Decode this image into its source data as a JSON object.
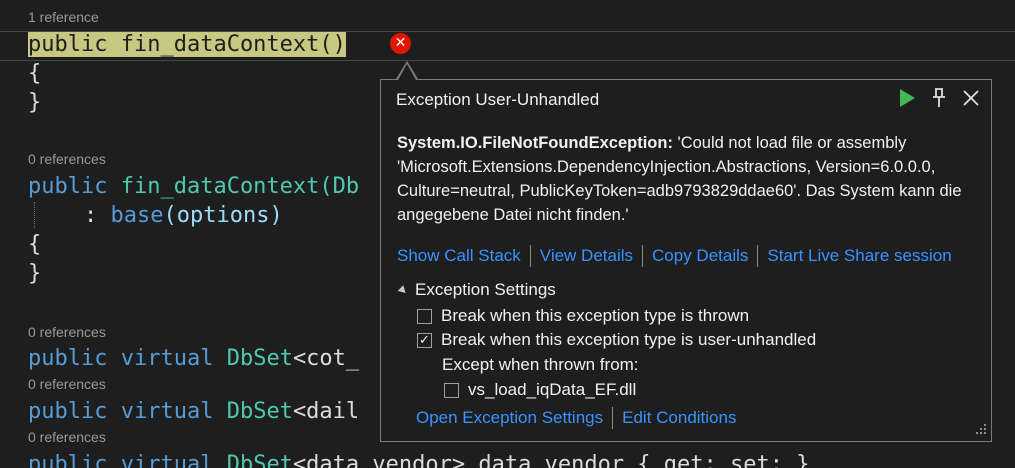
{
  "editor": {
    "codelens": [
      "1 reference",
      "0 references",
      "0 references",
      "0 references",
      "0 references"
    ],
    "lines": {
      "l1_kw": "public",
      "l1_name": "fin_dataContext()",
      "l2": "{",
      "l3": "}",
      "l4_kw": "public",
      "l4_name": "fin_dataContext(",
      "l4_type": "Db",
      "l5_colon": ": ",
      "l5_base": "base",
      "l5_args": "(options)",
      "l6": "{",
      "l7": "}",
      "l8_kw1": "public",
      "l8_kw2": "virtual",
      "l8_type": "DbSet",
      "l8_rest": "<cot_",
      "l9_kw1": "public",
      "l9_kw2": "virtual",
      "l9_type": "DbSet",
      "l9_rest": "<dail",
      "l10_kw1": "public",
      "l10_kw2": "virtual",
      "l10_type": "DbSet",
      "l10_rest": "<data_vendor> data_vendor { get; set; }"
    }
  },
  "popup": {
    "title": "Exception User-Unhandled",
    "exception_type": "System.IO.FileNotFoundException:",
    "message": "'Could not load file or assembly 'Microsoft.Extensions.DependencyInjection.Abstractions, Version=6.0.0.0, Culture=neutral, PublicKeyToken=adb9793829ddae60'. Das System kann die angegebene Datei nicht finden.'",
    "links": [
      "Show Call Stack",
      "View Details",
      "Copy Details",
      "Start Live Share session"
    ],
    "settings_header": "Exception Settings",
    "checkbox_thrown": "Break when this exception type is thrown",
    "checkbox_unhandled": "Break when this exception type is user-unhandled",
    "except_label": "Except when thrown from:",
    "checkbox_dll": "vs_load_iqData_EF.dll",
    "bottom_links": [
      "Open Exception Settings",
      "Edit Conditions"
    ],
    "checked": {
      "thrown": false,
      "unhandled": true,
      "dll": false
    }
  },
  "colors": {
    "keyword": "#569cd6",
    "type": "#4ec9b0",
    "link": "#3794ff",
    "error": "#e51400",
    "continue": "#3fb950",
    "highlight": "#c8c882"
  },
  "icons": [
    "error-icon",
    "continue-icon",
    "pin-icon",
    "close-icon",
    "collapse-triangle-icon",
    "checkmark-icon",
    "resize-grip-icon"
  ]
}
